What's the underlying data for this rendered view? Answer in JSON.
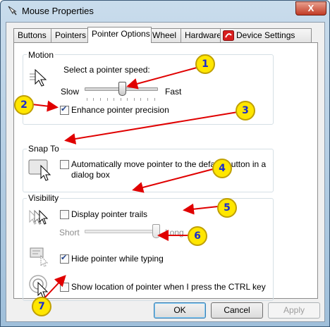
{
  "window": {
    "title": "Mouse Properties",
    "close_glyph": "X"
  },
  "tabs": [
    {
      "label": "Buttons"
    },
    {
      "label": "Pointers"
    },
    {
      "label": "Pointer Options"
    },
    {
      "label": "Wheel"
    },
    {
      "label": "Hardware"
    },
    {
      "label": "Device Settings"
    }
  ],
  "active_tab": "Pointer Options",
  "motion": {
    "title": "Motion",
    "speed_label": "Select a pointer speed:",
    "slow_label": "Slow",
    "fast_label": "Fast",
    "speed_value": 0.5,
    "enhance_label": "Enhance pointer precision",
    "enhance_checked": true
  },
  "snap_to": {
    "title": "Snap To",
    "auto_label_line1": "Automatically move pointer to the default button in a",
    "auto_label_line2": "dialog box",
    "auto_checked": false
  },
  "visibility": {
    "title": "Visibility",
    "trails_label": "Display pointer trails",
    "trails_checked": false,
    "short_label": "Short",
    "long_label": "Long",
    "trail_length_value": 1.0,
    "hide_label": "Hide pointer while typing",
    "hide_checked": true,
    "show_ctrl_label": "Show location of pointer when I press the CTRL key",
    "show_ctrl_checked": false
  },
  "buttons": {
    "ok": "OK",
    "cancel": "Cancel",
    "apply": "Apply"
  },
  "callouts": [
    "1",
    "2",
    "3",
    "4",
    "5",
    "6",
    "7"
  ],
  "colors": {
    "callout_fill": "#ffe600",
    "callout_text": "#1a2ccf",
    "arrow": "#e00000"
  }
}
